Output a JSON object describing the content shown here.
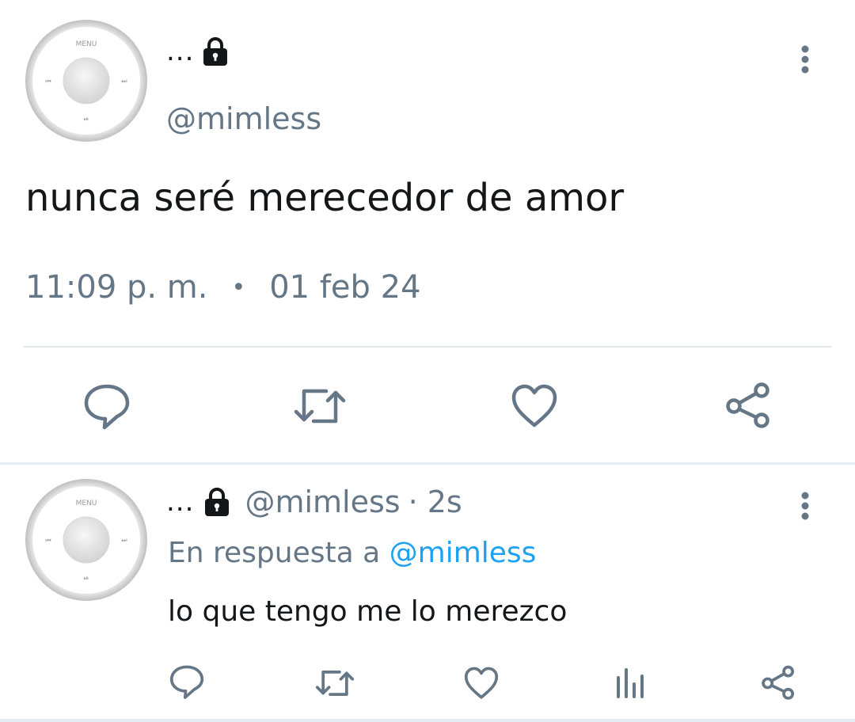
{
  "main_tweet": {
    "display_name": "...",
    "handle": "@mimless",
    "text": "nunca seré merecedor de amor",
    "time": "11:09 p. m.",
    "separator": "•",
    "date": "01 feb 24",
    "avatar": {
      "menu_label": "MENU",
      "prev_glyph": "⏮",
      "next_glyph": "⏭",
      "playpause_glyph": "⏯"
    },
    "icons": [
      "lock-icon",
      "more-vertical-icon",
      "reply-icon",
      "retweet-icon",
      "like-icon",
      "share-icon"
    ]
  },
  "reply_tweet": {
    "display_name": "...",
    "handle": "@mimless",
    "age": "· 2s",
    "reply_prefix": "En respuesta a",
    "reply_mention": "@mimless",
    "text": "lo que tengo me lo merezco",
    "icons": [
      "lock-icon",
      "more-vertical-icon",
      "reply-icon",
      "retweet-icon",
      "like-icon",
      "stats-icon",
      "share-icon"
    ]
  },
  "colors": {
    "text": "#14171a",
    "secondary": "#657786",
    "link": "#1da1f2",
    "divider": "#e1e8ed"
  }
}
